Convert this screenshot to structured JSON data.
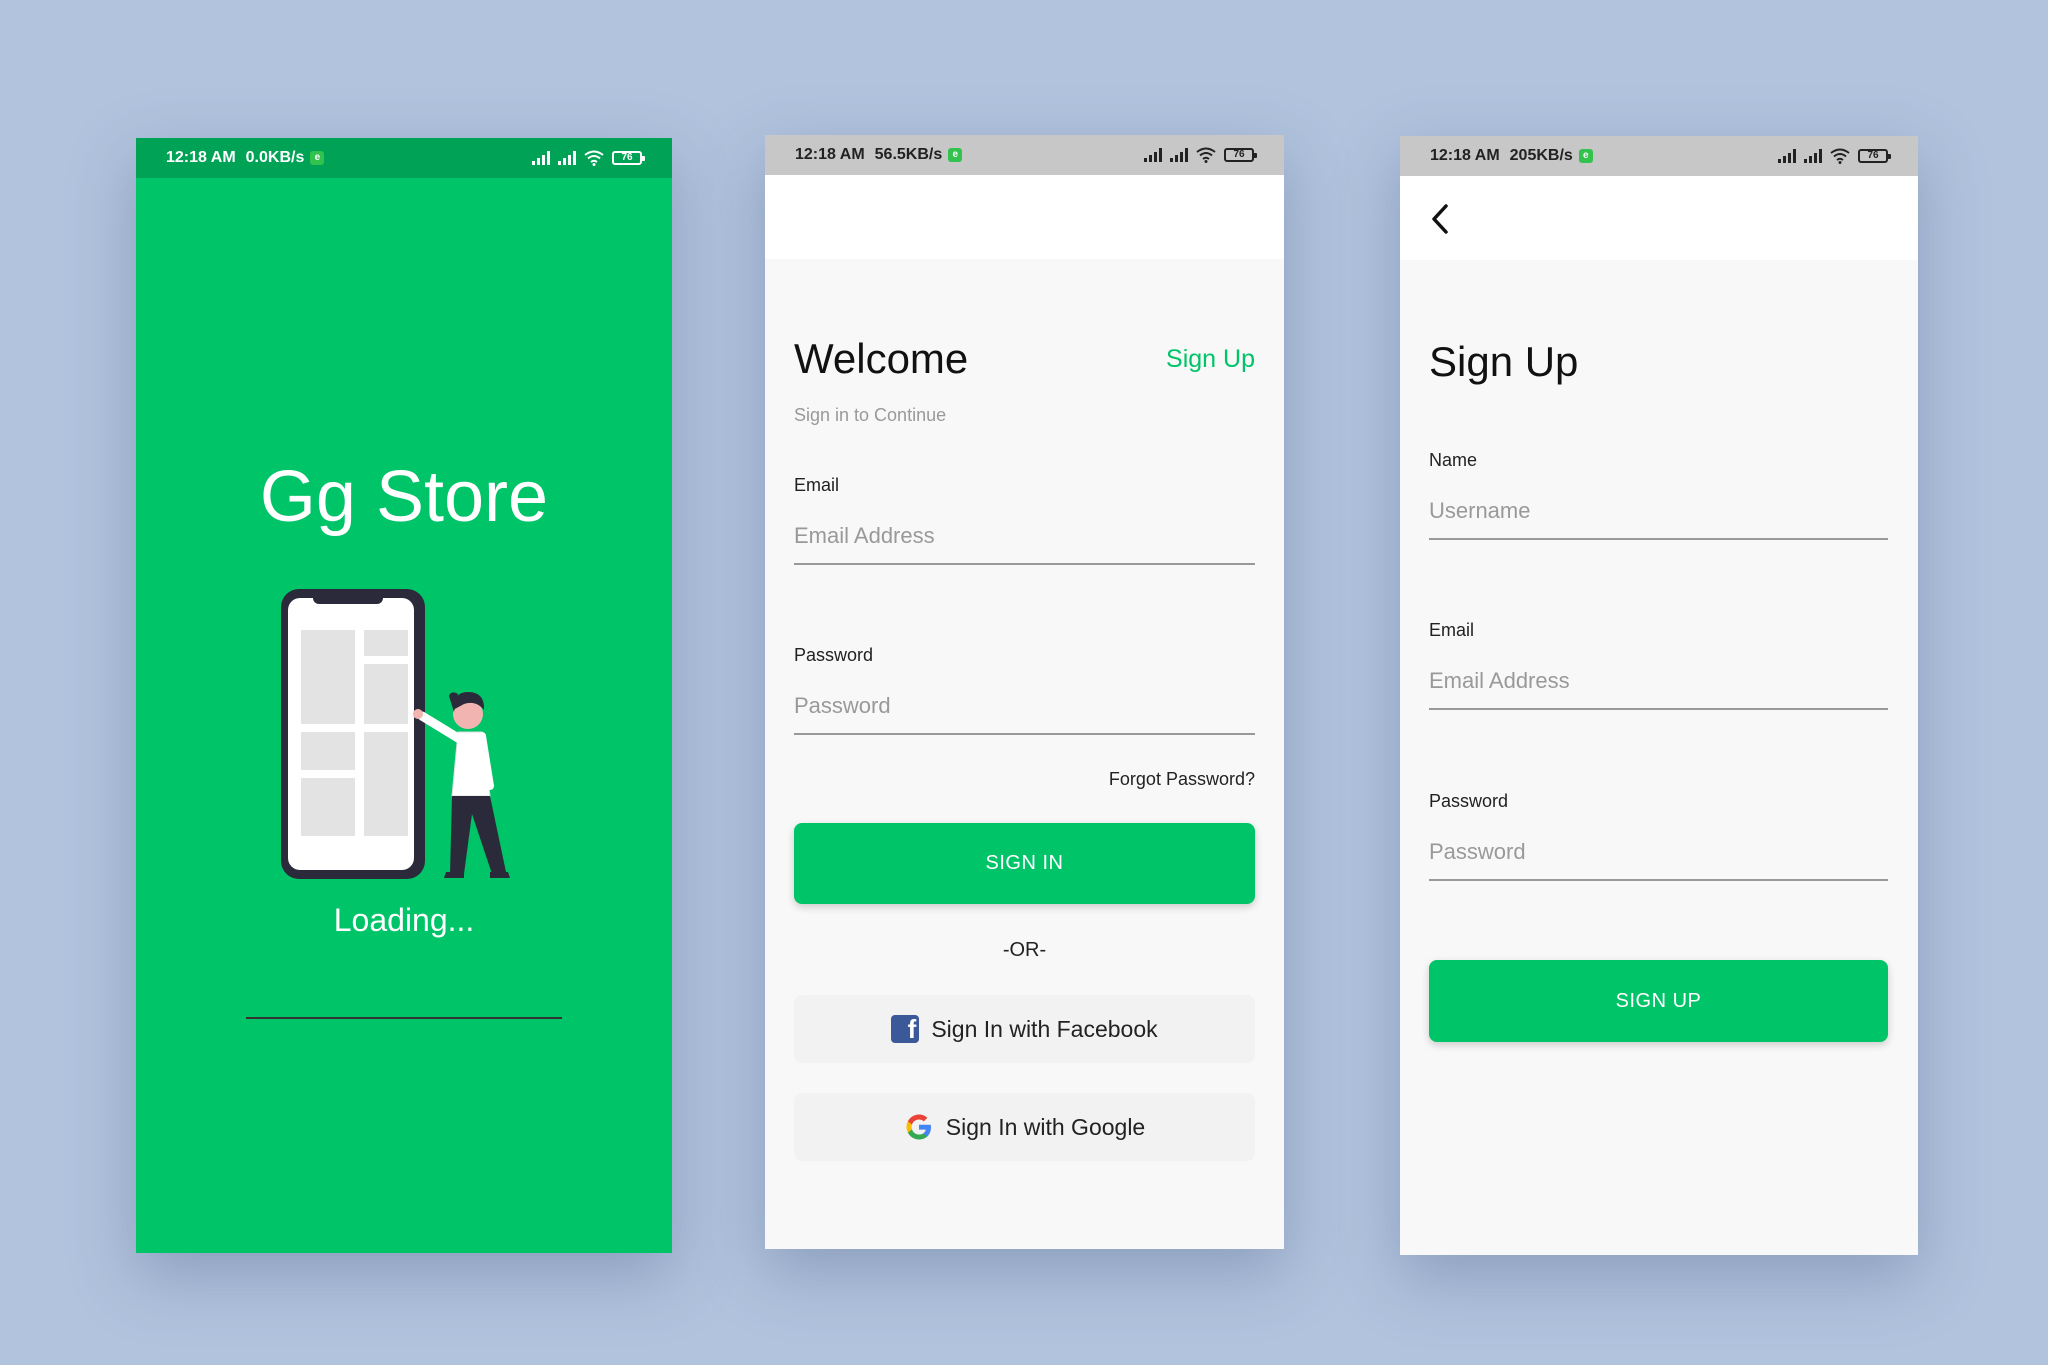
{
  "status_bar": {
    "time": "12:18 AM",
    "splash_speed": "0.0KB/s",
    "signin_speed": "56.5KB/s",
    "signup_speed": "205KB/s",
    "battery": "76",
    "vpn_badge": "e"
  },
  "splash": {
    "title": "Gg Store",
    "loading": "Loading..."
  },
  "signin": {
    "heading": "Welcome",
    "signup_link": "Sign Up",
    "subtitle": "Sign in to Continue",
    "email_label": "Email",
    "email_placeholder": "Email Address",
    "password_label": "Password",
    "password_placeholder": "Password",
    "forgot": "Forgot Password?",
    "signin_button": "SIGN IN",
    "or": "-OR-",
    "facebook_button": "Sign In with Facebook",
    "google_button": "Sign In with Google"
  },
  "signup": {
    "back_icon": "chevron-left-icon",
    "heading": "Sign Up",
    "name_label": "Name",
    "name_placeholder": "Username",
    "email_label": "Email",
    "email_placeholder": "Email Address",
    "password_label": "Password",
    "password_placeholder": "Password",
    "signup_button": "SIGN UP"
  },
  "colors": {
    "brand_green": "#00c468",
    "background": "#b1c3dd"
  }
}
